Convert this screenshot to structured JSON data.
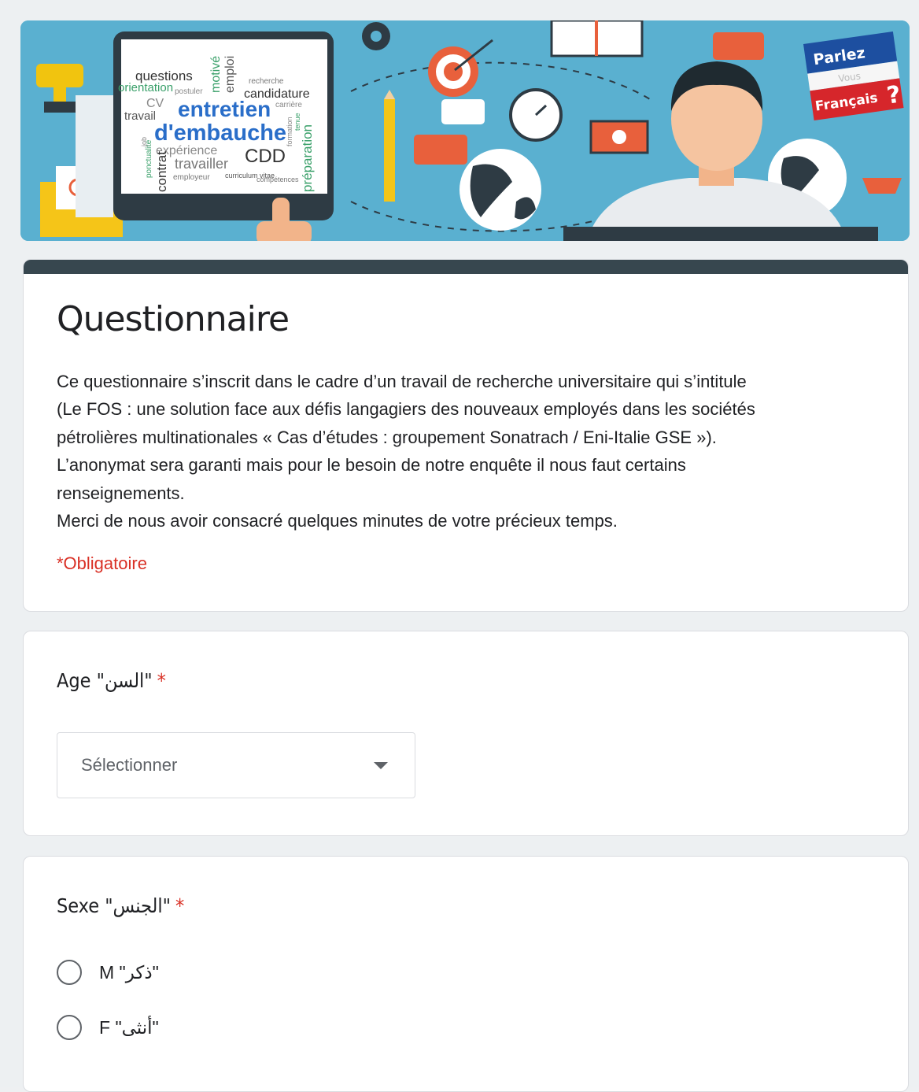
{
  "banner": {
    "screen_words": [
      "questions",
      "entretien",
      "d'embauche",
      "candidature",
      "CV",
      "travail",
      "expérience",
      "travailler",
      "CDD",
      "préparation",
      "motivé",
      "emploi",
      "recherche",
      "postuler",
      "employeur",
      "curriculum vitae",
      "compétences",
      "carrière",
      "contrat",
      "ponctualité",
      "orientation",
      "formation",
      "tenue",
      "job"
    ],
    "sign_lines": [
      "Parlez",
      "Vous",
      "Français",
      "?"
    ],
    "colors": {
      "sky": "#5ab0d0",
      "accent_orange": "#e8603c",
      "screen_frame": "#2e3b44"
    }
  },
  "form": {
    "title": "Questionnaire",
    "description_lines": [
      "Ce questionnaire s’inscrit dans le cadre d’un travail de recherche universitaire qui s’intitule",
      "(Le FOS : une solution face aux défis langagiers des nouveaux employés dans les sociétés",
      "pétrolières multinationales « Cas d’études : groupement Sonatrach / Eni-Italie GSE »).",
      "L’anonymat sera garanti mais pour le besoin de notre enquête il nous faut certains",
      "renseignements.",
      "Merci de nous avoir consacré quelques minutes de votre précieux temps."
    ],
    "required_note": "*Obligatoire",
    "accent_color": "#37474f",
    "required_color": "#d93025"
  },
  "questions": {
    "age": {
      "label": "Age \"السن\"",
      "required_mark": "*",
      "select_placeholder": "Sélectionner"
    },
    "sexe": {
      "label": "Sexe \"الجنس\"",
      "required_mark": "*",
      "options": [
        "M \"ذكر\"",
        "F \"أنثى\""
      ]
    }
  }
}
